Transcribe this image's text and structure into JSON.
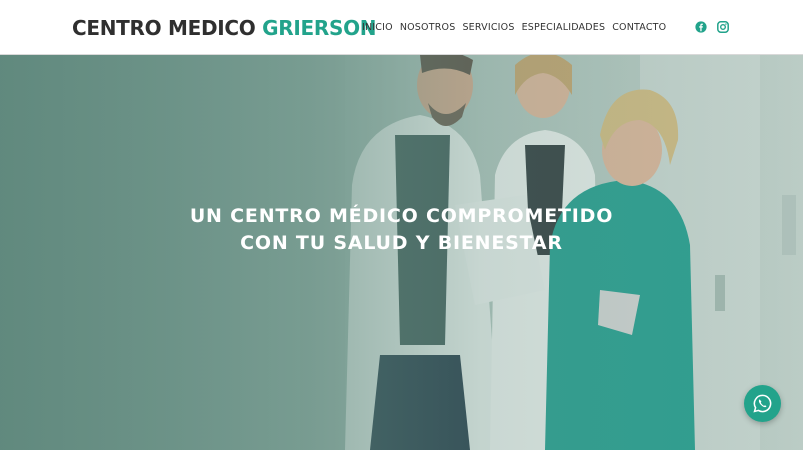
{
  "brand": {
    "name_main": "CENTRO MEDICO",
    "name_accent": "GRIERSON"
  },
  "nav": {
    "items": [
      {
        "label": "INICIO"
      },
      {
        "label": "NOSOTROS"
      },
      {
        "label": "SERVICIOS"
      },
      {
        "label": "ESPECIALIDADES"
      },
      {
        "label": "CONTACTO"
      }
    ]
  },
  "social": {
    "icons": [
      "facebook-icon",
      "instagram-icon"
    ]
  },
  "hero": {
    "title_line1": "UN CENTRO MÉDICO COMPROMETIDO",
    "title_line2": "CON TU SALUD Y BIENESTAR"
  },
  "floating": {
    "icon": "whatsapp-icon"
  },
  "colors": {
    "accent": "#22a38b",
    "text_dark": "#2f2f2f",
    "hero_tint": "#6e968a"
  }
}
